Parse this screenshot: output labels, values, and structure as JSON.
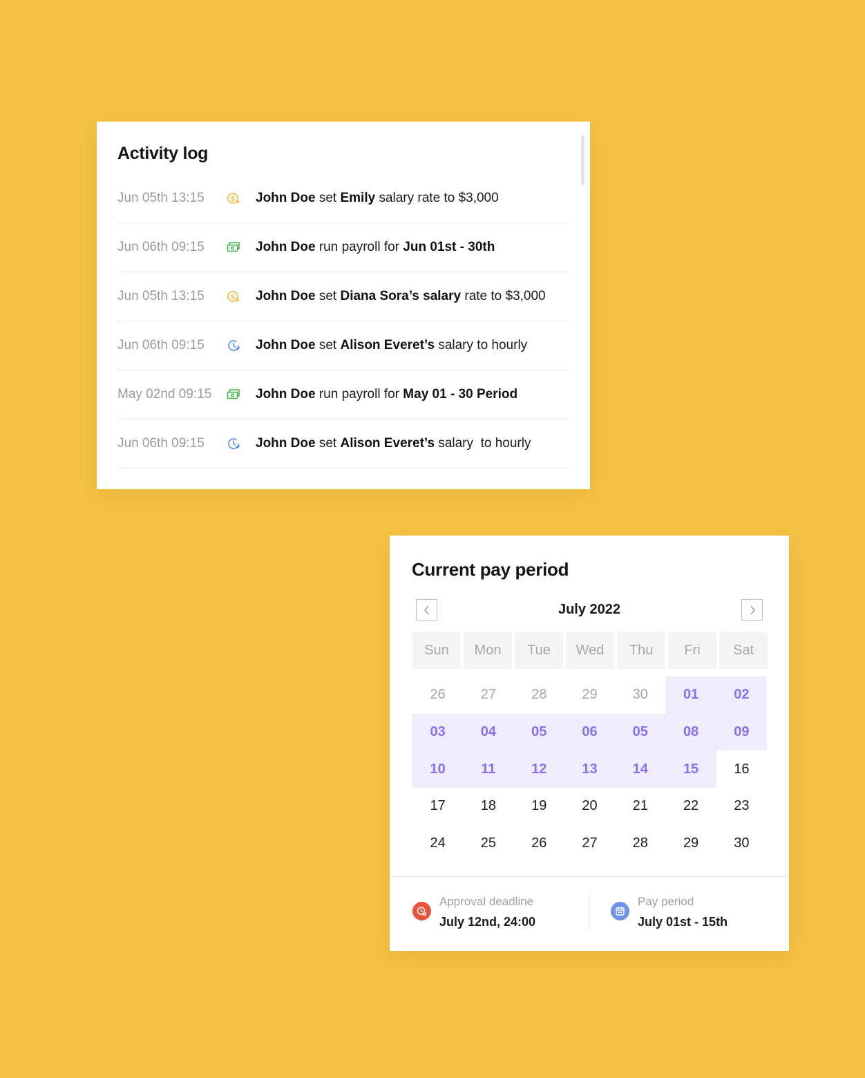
{
  "colors": {
    "background": "#F5C243",
    "accent_purple": "#8B6FF0",
    "period_highlight": "#EFEDFC",
    "salary_icon": "#F2B93B",
    "payroll_icon": "#3FB045",
    "hourly_icon": "#5B8DEF",
    "deadline_icon": "#E8533B",
    "pay_period_icon": "#6E93E8"
  },
  "activity_log": {
    "title": "Activity log",
    "entries": [
      {
        "time": "Jun 05th 13:15",
        "icon": "dollar-coin-icon",
        "actor": "John Doe",
        "verb": " set ",
        "subject": "Emily",
        "rest": " salary rate to $3,000"
      },
      {
        "time": "Jun 06th 09:15",
        "icon": "banknote-icon",
        "actor": "John Doe",
        "verb": " run payroll for ",
        "subject": "Jun 01st - 30th",
        "rest": ""
      },
      {
        "time": "Jun 05th 13:15",
        "icon": "dollar-coin-icon",
        "actor": "John Doe",
        "verb": " set ",
        "subject": "Diana Sora’s salary",
        "rest": " rate to $3,000"
      },
      {
        "time": "Jun 06th 09:15",
        "icon": "clock-icon",
        "actor": "John Doe",
        "verb": " set ",
        "subject": "Alison Everet’s",
        "rest": " salary to hourly"
      },
      {
        "time": "May 02nd 09:15",
        "icon": "banknote-icon",
        "actor": "John Doe",
        "verb": " run payroll for ",
        "subject": "May 01 - 30 Period",
        "rest": ""
      },
      {
        "time": "Jun 06th 09:15",
        "icon": "clock-icon",
        "actor": "John Doe",
        "verb": " set ",
        "subject": "Alison Everet’s",
        "rest": " salary  to hourly"
      }
    ]
  },
  "pay_period": {
    "title": "Current pay period",
    "month": "July 2022",
    "weekdays": [
      "Sun",
      "Mon",
      "Tue",
      "Wed",
      "Thu",
      "Fri",
      "Sat"
    ],
    "days": [
      {
        "label": "26",
        "state": "muted"
      },
      {
        "label": "27",
        "state": "muted"
      },
      {
        "label": "28",
        "state": "muted"
      },
      {
        "label": "29",
        "state": "muted"
      },
      {
        "label": "30",
        "state": "muted"
      },
      {
        "label": "01",
        "state": "in-period"
      },
      {
        "label": "02",
        "state": "in-period"
      },
      {
        "label": "03",
        "state": "in-period"
      },
      {
        "label": "04",
        "state": "in-period"
      },
      {
        "label": "05",
        "state": "in-period"
      },
      {
        "label": "06",
        "state": "in-period"
      },
      {
        "label": "05",
        "state": "in-period"
      },
      {
        "label": "08",
        "state": "in-period"
      },
      {
        "label": "09",
        "state": "in-period"
      },
      {
        "label": "10",
        "state": "in-period"
      },
      {
        "label": "11",
        "state": "in-period"
      },
      {
        "label": "12",
        "state": "in-period"
      },
      {
        "label": "13",
        "state": "in-period"
      },
      {
        "label": "14",
        "state": "in-period"
      },
      {
        "label": "15",
        "state": "in-period"
      },
      {
        "label": "16",
        "state": "normal"
      },
      {
        "label": "17",
        "state": "normal"
      },
      {
        "label": "18",
        "state": "normal"
      },
      {
        "label": "19",
        "state": "normal"
      },
      {
        "label": "20",
        "state": "normal"
      },
      {
        "label": "21",
        "state": "normal"
      },
      {
        "label": "22",
        "state": "normal"
      },
      {
        "label": "23",
        "state": "normal"
      },
      {
        "label": "24",
        "state": "normal"
      },
      {
        "label": "25",
        "state": "normal"
      },
      {
        "label": "26",
        "state": "normal"
      },
      {
        "label": "27",
        "state": "normal"
      },
      {
        "label": "28",
        "state": "normal"
      },
      {
        "label": "29",
        "state": "normal"
      },
      {
        "label": "30",
        "state": "normal"
      }
    ],
    "approval": {
      "label": "Approval deadline",
      "value": "July 12nd, 24:00",
      "icon": "deadline-clock-icon"
    },
    "period": {
      "label": "Pay period",
      "value": "July 01st - 15th",
      "icon": "calendar-icon"
    }
  }
}
